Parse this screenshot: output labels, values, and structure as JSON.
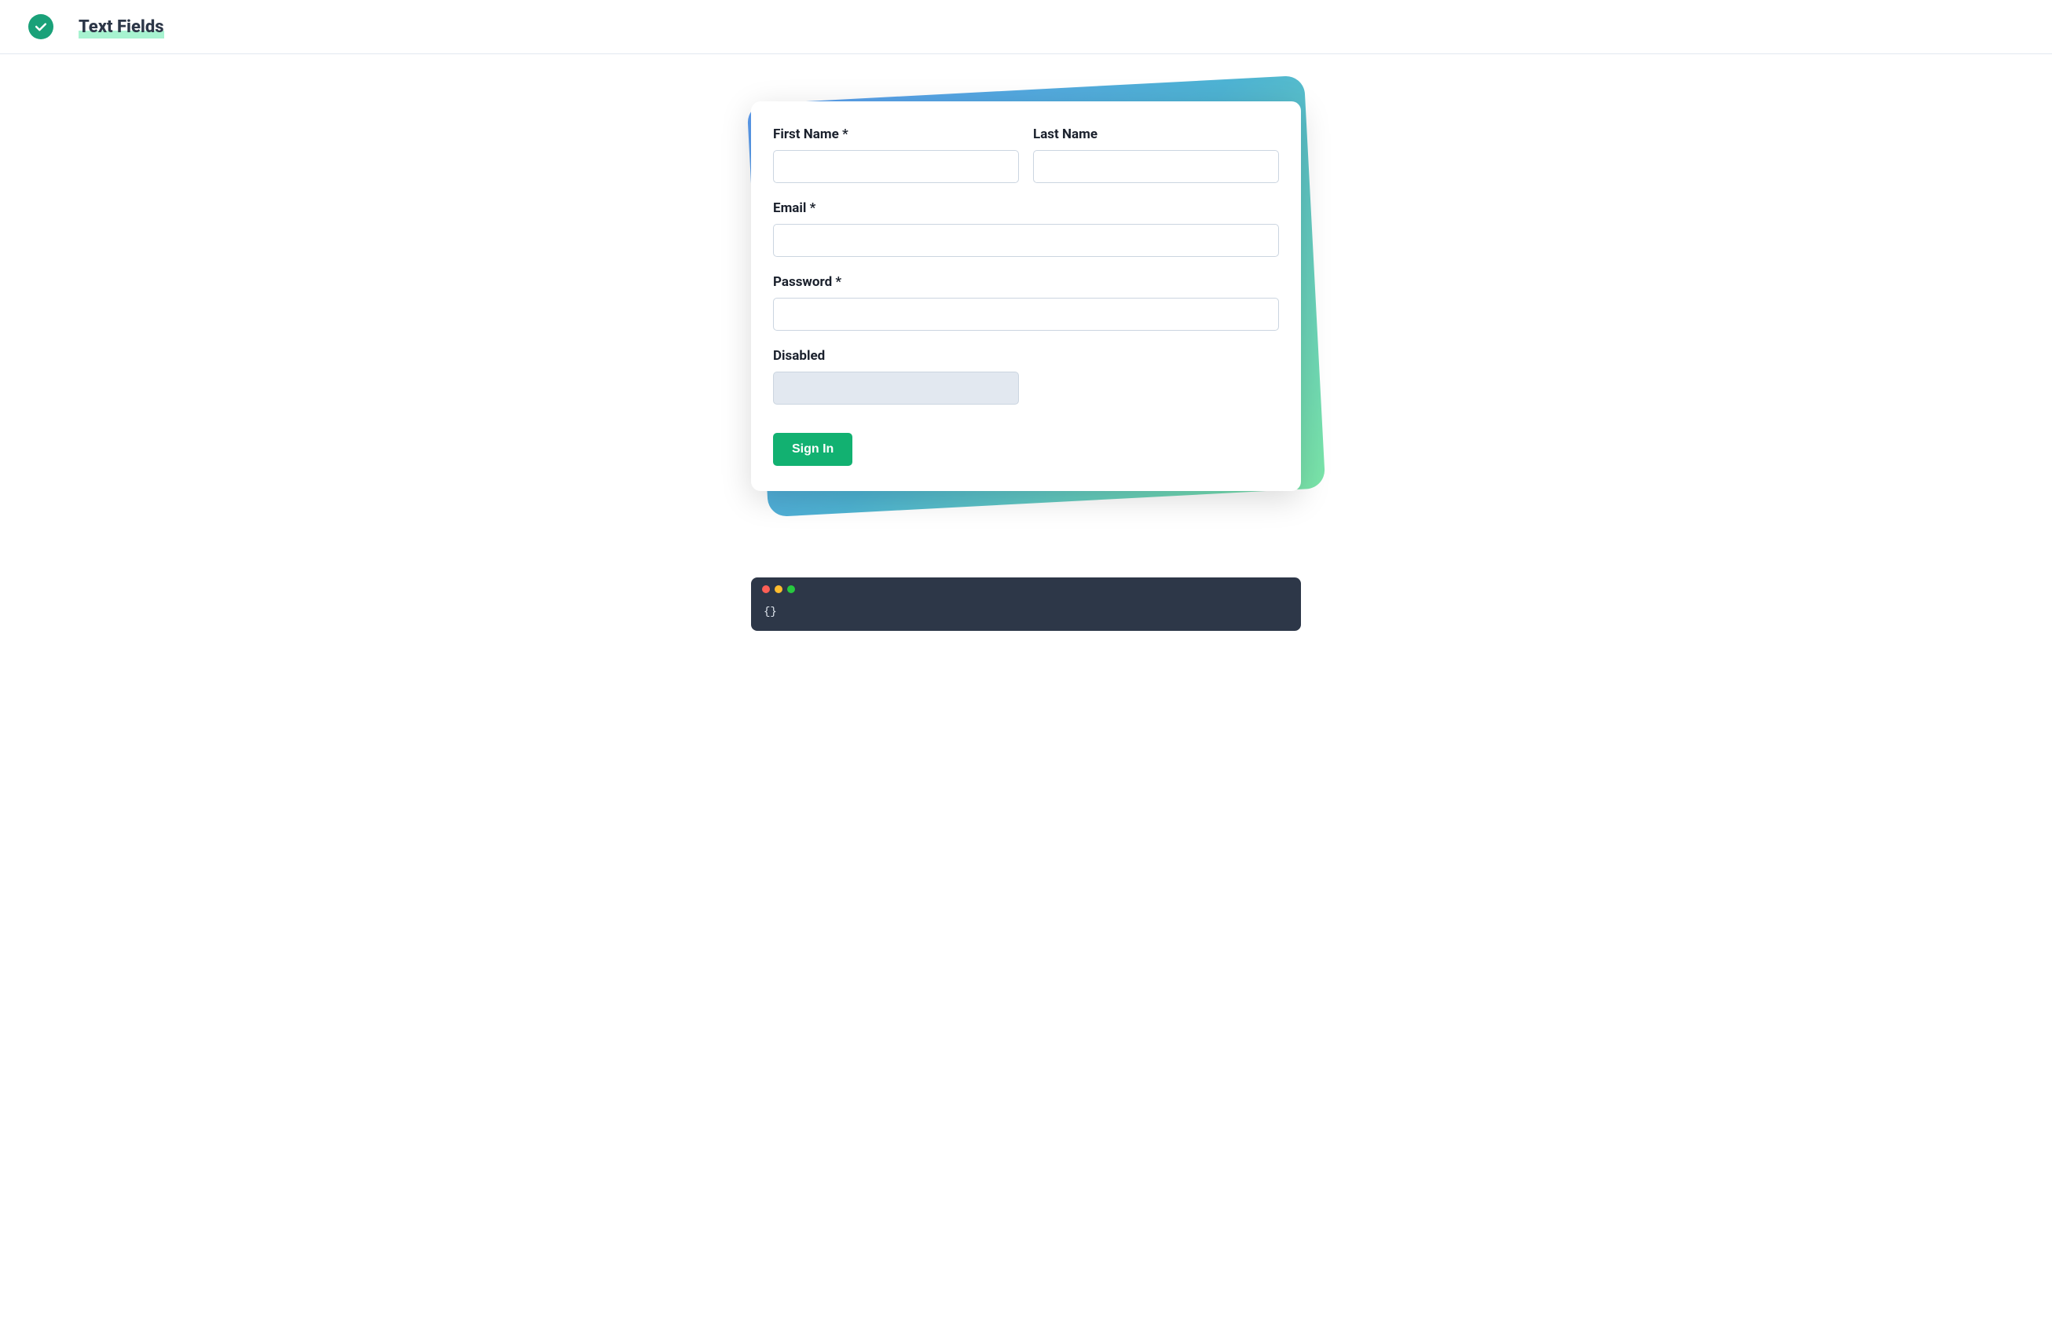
{
  "header": {
    "title": "Text Fields"
  },
  "form": {
    "fields": {
      "firstName": {
        "label": "First Name *",
        "value": ""
      },
      "lastName": {
        "label": "Last Name",
        "value": ""
      },
      "email": {
        "label": "Email *",
        "value": ""
      },
      "password": {
        "label": "Password *",
        "value": ""
      },
      "disabled": {
        "label": "Disabled",
        "value": ""
      }
    },
    "submitLabel": "Sign In"
  },
  "codeOutput": {
    "content": "{}"
  }
}
